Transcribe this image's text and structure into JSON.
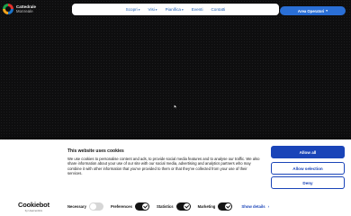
{
  "header": {
    "logo": {
      "line1": "Cattedrale",
      "line2": "Monreale"
    },
    "nav": [
      {
        "label": "Scopri",
        "has_dropdown": true
      },
      {
        "label": "Visi",
        "has_dropdown": true
      },
      {
        "label": "Pianifica",
        "has_dropdown": true
      },
      {
        "label": "Eventi",
        "has_dropdown": false
      },
      {
        "label": "Contatti",
        "has_dropdown": false
      }
    ],
    "cta_label": "Area Operatori"
  },
  "cookie_banner": {
    "title": "This website uses cookies",
    "body": "We use cookies to personalise content and ads, to provide social media features and to analyse our traffic. We also share information about your use of our site with our social media, advertising and analytics partners who may combine it with other information that you've provided to them or that they've collected from your use of their services.",
    "brand": {
      "name": "Cookiebot",
      "sub": "by Usercentrics"
    },
    "toggles": [
      {
        "label": "Necessary",
        "state": "off"
      },
      {
        "label": "Preferences",
        "state": "on"
      },
      {
        "label": "Statistics",
        "state": "on"
      },
      {
        "label": "Marketing",
        "state": "on"
      }
    ],
    "show_details": "Show details",
    "buttons": {
      "allow_all": "Allow all",
      "allow_selection": "Allow selection",
      "deny": "Deny"
    }
  },
  "colors": {
    "accent": "#1a44b8",
    "nav_link": "#1f5fb4",
    "cta": "#2a6fd6",
    "page_bg": "#0e0e0f"
  }
}
